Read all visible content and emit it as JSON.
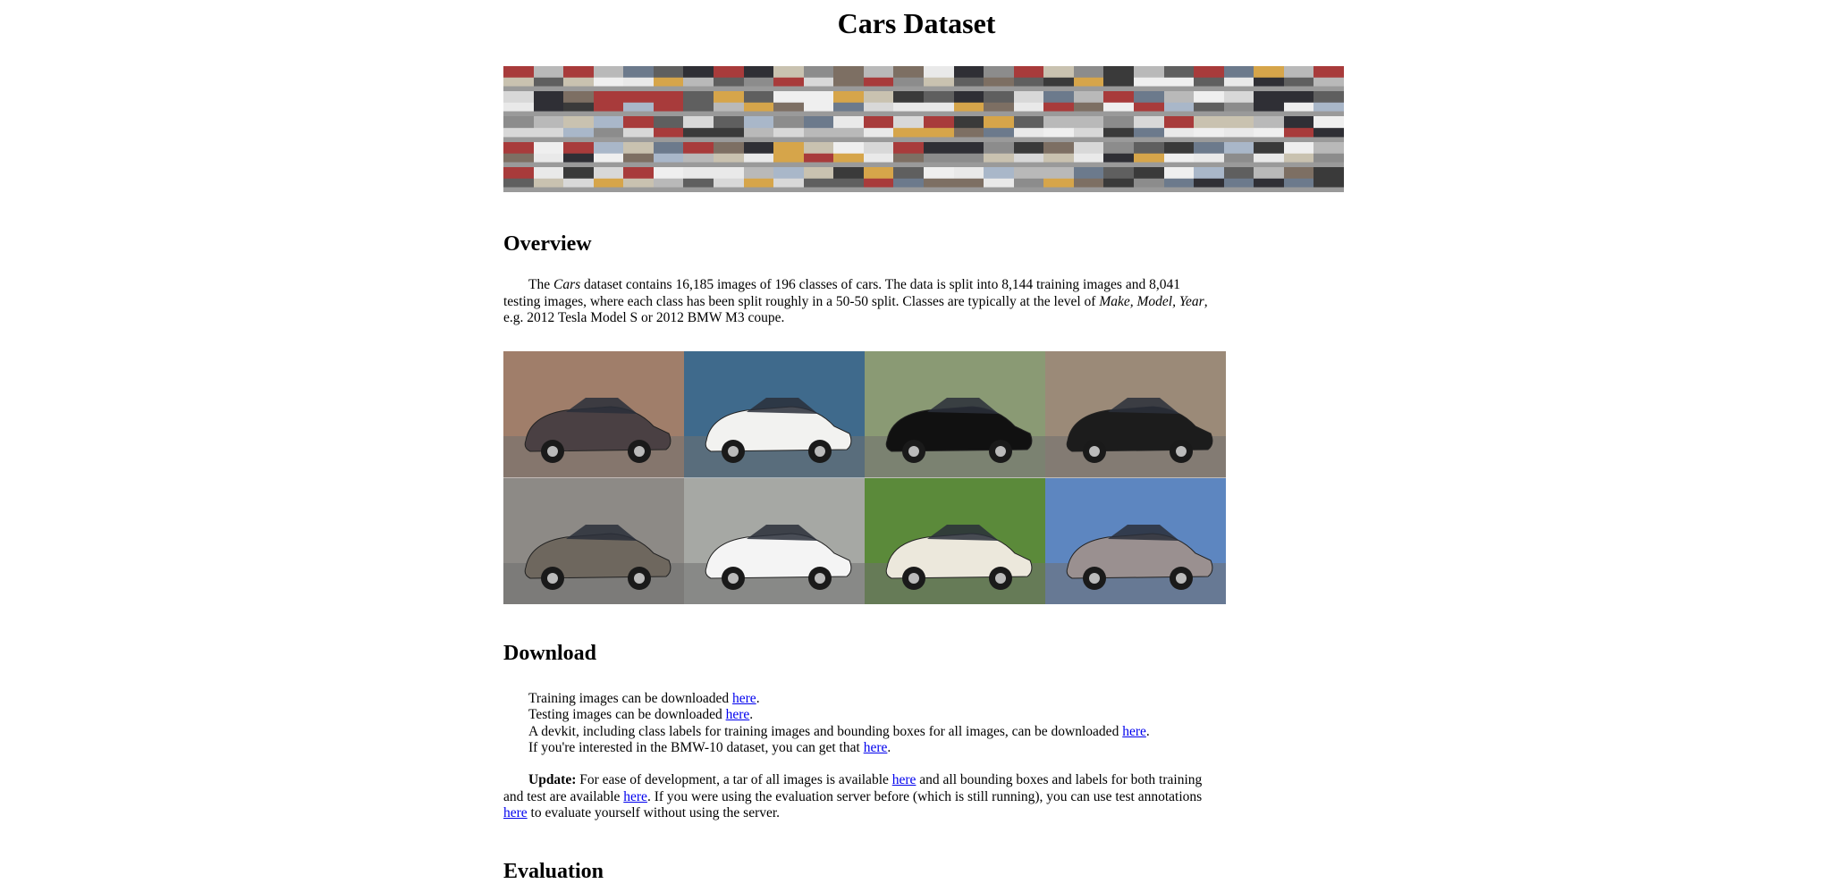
{
  "title": "Cars Dataset",
  "overview": {
    "heading": "Overview",
    "text_1": "The ",
    "dataset_name": "Cars",
    "text_2": " dataset contains 16,185 images of 196 classes of cars. The data is split into 8,144 training images and 8,041 testing images, where each class has been split roughly in a 50-50 split. Classes are typically at the level of ",
    "level": "Make, Model, Year",
    "text_3": ", e.g. 2012 Tesla Model S or 2012 BMW M3 coupe."
  },
  "download": {
    "heading": "Download",
    "lines": [
      {
        "prefix": "Training images can be downloaded ",
        "link": "here",
        "suffix": "."
      },
      {
        "prefix": "Testing images can be downloaded ",
        "link": "here",
        "suffix": "."
      },
      {
        "prefix": "A devkit, including class labels for training images and bounding boxes for all images, can be downloaded ",
        "link": "here",
        "suffix": "."
      },
      {
        "prefix": "If you're interested in the BMW-10 dataset, you can get that ",
        "link": "here",
        "suffix": "."
      }
    ],
    "update_label": "Update:",
    "update_1": " For ease of development, a tar of all images is available ",
    "update_link_1": "here",
    "update_2": " and all bounding boxes and labels for both training and test are available ",
    "update_link_2": "here",
    "update_3": ". If you were using the evaluation server before (which is still running), you can use test annotations ",
    "update_link_3": "here",
    "update_4": " to evaluate yourself without using the server."
  },
  "evaluation": {
    "heading": "Evaluation"
  },
  "photos": [
    {
      "name": "gray-sedan-photo",
      "bg": "#a07e6a",
      "car": "#4a4043"
    },
    {
      "name": "white-convertible-photo",
      "bg": "#3f6a8c",
      "car": "#f2f2f0"
    },
    {
      "name": "black-sedan-photo",
      "bg": "#8a9a74",
      "car": "#111111"
    },
    {
      "name": "black-sports-car-photo",
      "bg": "#9b8a78",
      "car": "#1c1c1c"
    },
    {
      "name": "gray-suv-photo",
      "bg": "#8d8a86",
      "car": "#6e675e"
    },
    {
      "name": "white-compact-photo",
      "bg": "#a6a8a4",
      "car": "#f4f4f4"
    },
    {
      "name": "white-coupe-photo",
      "bg": "#5b8a3a",
      "car": "#ece8dc"
    },
    {
      "name": "silver-crossover-photo",
      "bg": "#5d86c0",
      "car": "#9a9090"
    }
  ]
}
